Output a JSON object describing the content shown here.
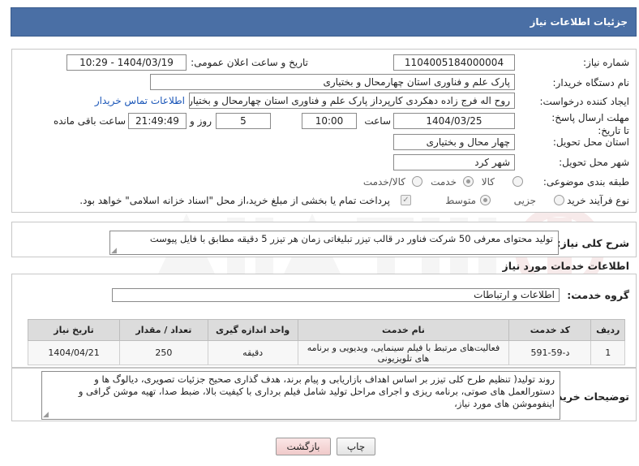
{
  "header": {
    "title": "جزئیات اطلاعات نیاز"
  },
  "form": {
    "need_number": {
      "label": "شماره نیاز:",
      "value": "1104005184000004"
    },
    "announce_datetime": {
      "label": "تاریخ و ساعت اعلان عمومی:",
      "value": "1404/03/19 - 10:29"
    },
    "buyer_org": {
      "label": "نام دستگاه خریدار:",
      "value": "پارک علم و فناوری استان چهارمحال و بختیاری"
    },
    "requester": {
      "label": "ایجاد کننده درخواست:",
      "value": "روح اله فرج زاده دهکردی کارپرداز پارک علم و فناوری استان چهارمحال و بختیاری",
      "contact_link": "اطلاعات تماس خریدار"
    },
    "deadline": {
      "label": "مهلت ارسال پاسخ: تا تاریخ:",
      "date": "1404/03/25",
      "time_label": "ساعت",
      "time": "10:00",
      "days": "5",
      "days_label": "روز و",
      "remaining": "21:49:49",
      "remaining_label": "ساعت باقی مانده"
    },
    "province": {
      "label": "استان محل تحویل:",
      "value": "چهار محال و بختیاری"
    },
    "city": {
      "label": "شهر محل تحویل:",
      "value": "شهر کرد"
    },
    "category": {
      "label": "طبقه بندی موضوعی:",
      "options": [
        "کالا",
        "خدمت",
        "کالا/خدمت"
      ],
      "selected": "خدمت"
    },
    "purchase_type": {
      "label": "نوع فرآیند خرید :",
      "options": [
        "جزیی",
        "متوسط"
      ],
      "selected": "متوسط",
      "treasury_note": "پرداخت تمام یا بخشی از مبلغ خرید،از محل \"اسناد خزانه اسلامی\" خواهد بود."
    }
  },
  "summary": {
    "label": "شرح کلی نیاز:",
    "value": "تولید محتوای معرفی 50 شرکت فناور در قالب تیزر تبلیغاتی زمان هر تیزر 5 دقیقه مطابق با فایل پیوست"
  },
  "services": {
    "section_title": "اطلاعات خدمات مورد نیاز",
    "group_label": "گروه خدمت:",
    "group_value": "اطلاعات و ارتباطات",
    "columns": [
      "ردیف",
      "کد خدمت",
      "نام خدمت",
      "واحد اندازه گیری",
      "تعداد / مقدار",
      "تاریخ نیاز"
    ],
    "rows": [
      [
        "1",
        "د-59-591",
        "فعالیت‌های مرتبط با فیلم سینمایی، ویدیویی و برنامه های تلویزیونی",
        "دقیقه",
        "250",
        "1404/04/21"
      ]
    ]
  },
  "buyer_notes": {
    "label": "توضیحات خریدار:",
    "value": "روند تولید( تنظیم طرح کلی تیزر بر اساس اهداف بازاریابی و پیام برند، هدف گذاری صحیح جزئیات تصویری، دیالوگ ها و دستورالعمل های صوتی، برنامه ریزی و اجرای مراحل تولید شامل فیلم برداری با کیفیت بالا، ضبط صدا، تهیه موشن گرافی و اینفوموشن های مورد نیاز،"
  },
  "actions": {
    "print": "چاپ",
    "back": "بازگشت"
  },
  "colors": {
    "header": "#4a6fa5",
    "link": "#1a56b8",
    "back_button": "#f0caca"
  }
}
